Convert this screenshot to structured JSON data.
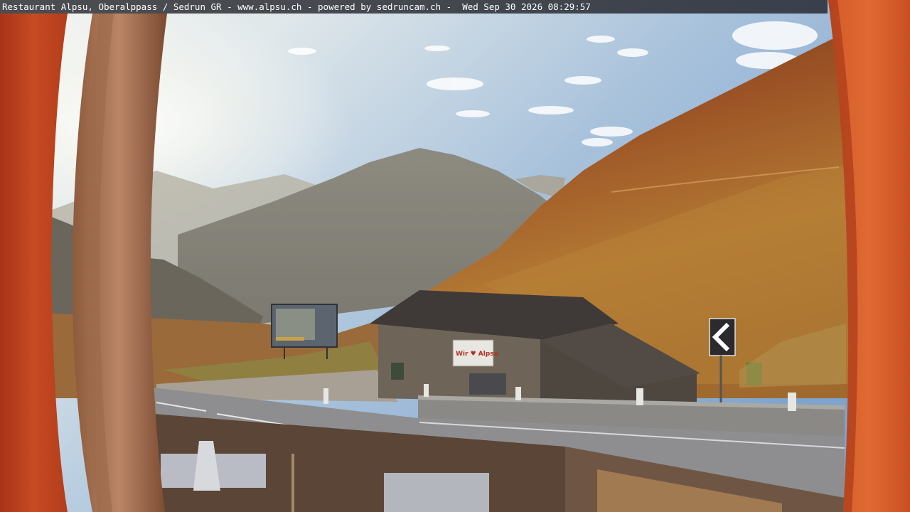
{
  "overlay": {
    "caption": "Restaurant Alpsu, Oberalppass / Sedrun GR - www.alpsu.ch - powered by sedruncam.ch -  Wed Sep 30 2026 08:29:57"
  },
  "scene": {
    "description_icons": [
      "mountain-peak",
      "hut-roof",
      "road-curve-sign-icon"
    ],
    "hut_sign_text": "Wir ♥ Alpsu",
    "colors": {
      "sky_top": "#7fa7cf",
      "sky_glow": "#eef2ee",
      "slope_sunlit": "#b8752e",
      "slope_dark": "#7a3b1c",
      "frame_red": "#c4461f",
      "road": "#8f8f90",
      "hut_wood": "#6e6558"
    }
  }
}
